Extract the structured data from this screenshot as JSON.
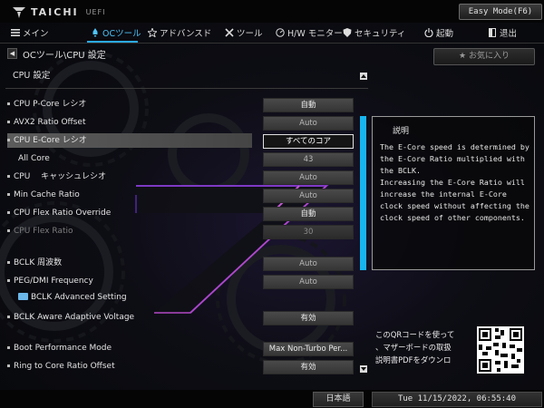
{
  "header": {
    "logo_name": "TAICHI",
    "logo_suffix": "UEFI",
    "easy_mode_label": "Easy Mode(F6)"
  },
  "nav": [
    {
      "label": "メイン",
      "icon": "menu-icon"
    },
    {
      "label": "OCツール",
      "icon": "rocket-icon",
      "active": true
    },
    {
      "label": "アドバンスド",
      "icon": "star-icon"
    },
    {
      "label": "ツール",
      "icon": "tools-icon"
    },
    {
      "label": "H/W モニター",
      "icon": "monitor-icon"
    },
    {
      "label": "セキュリティ",
      "icon": "shield-icon"
    },
    {
      "label": "起動",
      "icon": "power-icon"
    },
    {
      "label": "退出",
      "icon": "exit-icon"
    }
  ],
  "breadcrumb": "OCツール\\CPU 設定",
  "favorite_label": "お気に入り",
  "section_title": "CPU 設定",
  "rows": [
    {
      "label": "CPU P-Core レシオ",
      "value": "自動"
    },
    {
      "label": "AVX2 Ratio Offset",
      "value": "Auto"
    },
    {
      "label": "CPU E-Core レシオ",
      "value": "すべてのコア"
    },
    {
      "label": "All Core",
      "value": "43"
    },
    {
      "label": "CPU　 キャッシュレシオ",
      "value": "Auto"
    },
    {
      "label": "Min Cache  Ratio",
      "value": "Auto"
    },
    {
      "label": "CPU Flex  Ratio Override",
      "value": "自動"
    },
    {
      "label": "CPU Flex  Ratio",
      "value": "30"
    },
    {
      "label": "BCLK 周波数",
      "value": "Auto"
    },
    {
      "label": "PEG/DMI Frequency",
      "value": "Auto"
    },
    {
      "label": "BCLK Advanced Setting",
      "value": ""
    },
    {
      "label": "BCLK Aware Adaptive Voltage",
      "value": "有効"
    },
    {
      "label": "Boot Performance Mode",
      "value": "Max Non-Turbo Per..."
    },
    {
      "label": "Ring to Core Ratio Offset",
      "value": "有効"
    }
  ],
  "help": {
    "title": "説明",
    "body": "The E-Core speed is determined by the E-Core Ratio multiplied with the BCLK.\nIncreasing the E-Core Ratio will increase the internal E-Core clock speed without affecting the clock speed of other components."
  },
  "qr_text": "このQRコードを使って\n、マザーボードの取扱\n説明書PDFをダウンロ",
  "footer": {
    "language": "日本語",
    "datetime": "Tue 11/15/2022, 06:55:40"
  },
  "colors": {
    "accent": "#2aa9e0",
    "scrollbar": "#17b4f0",
    "background": "#0b0c0f"
  }
}
